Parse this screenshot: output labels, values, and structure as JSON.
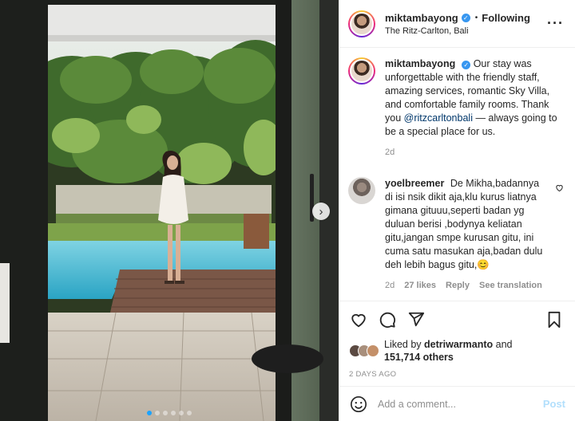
{
  "post": {
    "author": "miktambayong",
    "follow_status": "Following",
    "separator": "•",
    "location": "The Ritz-Carlton, Bali",
    "more_label": "···",
    "verified_mark": "✓"
  },
  "caption": {
    "author": "miktambayong",
    "text_before": "Our stay was unforgettable with the friendly staff, amazing services, romantic Sky Villa, and comfortable family rooms. Thank you ",
    "mention": "@ritzcarltonbali",
    "text_after": " — always going to be a special place for us.",
    "age": "2d"
  },
  "comments": [
    {
      "author": "yoelbreemer",
      "text": "De Mikha,badannya di isi nsik dikit aja,klu kurus liatnya gimana gituuu,seperti badan yg duluan berisi ,bodynya keliatan gitu,jangan smpe kurusan gitu, ini cuma satu masukan aja,badan dulu deh lebih bagus gitu,😊",
      "age": "2d",
      "likes": "27 likes",
      "reply": "Reply",
      "translate": "See translation"
    }
  ],
  "likes": {
    "prefix": "Liked by ",
    "liker": "detriwarmanto",
    "and": " and",
    "others": "151,714 others"
  },
  "timestamp": "2 DAYS AGO",
  "add_comment": {
    "placeholder": "Add a comment...",
    "post_label": "Post"
  },
  "carousel": {
    "total_slides": 6,
    "active_slide": 1,
    "next_label": "›"
  },
  "colors": {
    "accent": "#3897f0",
    "post_button_disabled": "#b2dffc",
    "link": "#00376b",
    "muted": "#8e8e8e",
    "carousel_active_dot": "#1aa3ff"
  },
  "icons": [
    "heart-icon",
    "comment-icon",
    "share-icon",
    "bookmark-icon",
    "emoji-icon",
    "more-icon",
    "chevron-right-icon"
  ]
}
